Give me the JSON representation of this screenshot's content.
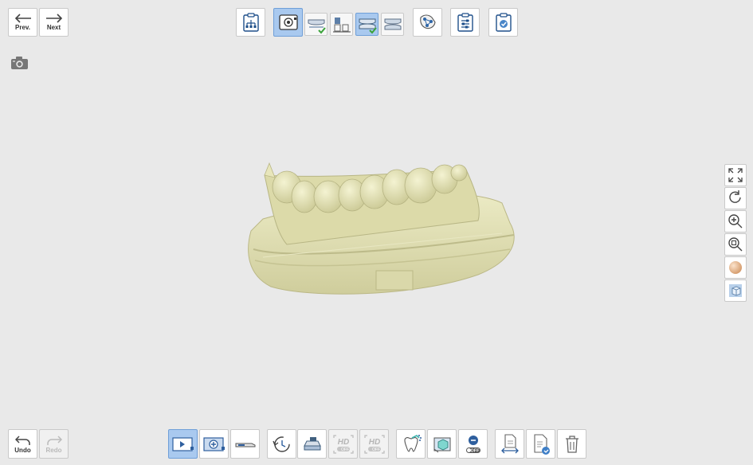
{
  "nav": {
    "prev_label": "Prev.",
    "next_label": "Next"
  },
  "history": {
    "undo_label": "Undo",
    "redo_label": "Redo"
  },
  "bottom_toolbar": {
    "hd_label_1": "HD",
    "hd_label_2": "HD",
    "off_label_1": "OFF",
    "off_label_2": "OFF",
    "off_label_3": "OFF"
  },
  "colors": {
    "accent": "#a9c9ef",
    "model": "#e3e1b4",
    "background": "#e9e9e9"
  }
}
